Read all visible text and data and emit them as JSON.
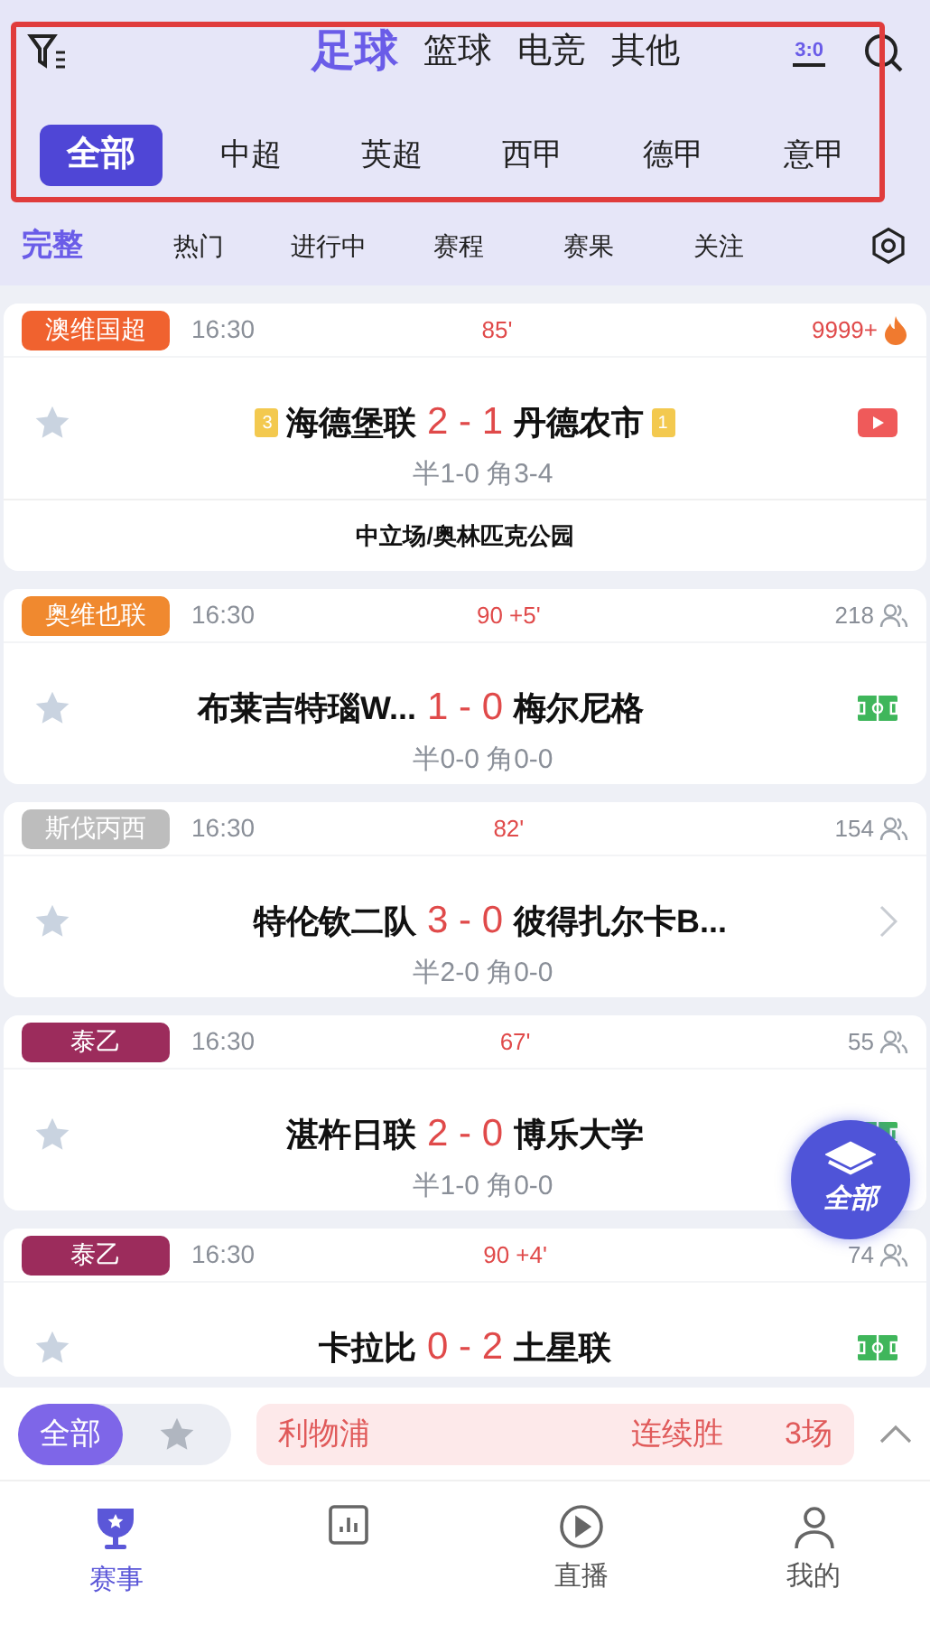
{
  "sports": [
    {
      "label": "足球",
      "selected": true
    },
    {
      "label": "篮球",
      "selected": false
    },
    {
      "label": "电竞",
      "selected": false
    },
    {
      "label": "其他",
      "selected": false
    }
  ],
  "score_toggle": "3:0",
  "leagues": [
    {
      "label": "全部",
      "selected": true
    },
    {
      "label": "中超",
      "selected": false
    },
    {
      "label": "英超",
      "selected": false
    },
    {
      "label": "西甲",
      "selected": false
    },
    {
      "label": "德甲",
      "selected": false
    },
    {
      "label": "意甲",
      "selected": false
    }
  ],
  "filters": [
    {
      "label": "完整",
      "selected": true
    },
    {
      "label": "热门",
      "selected": false
    },
    {
      "label": "进行中",
      "selected": false
    },
    {
      "label": "赛程",
      "selected": false
    },
    {
      "label": "赛果",
      "selected": false
    },
    {
      "label": "关注",
      "selected": false
    }
  ],
  "matches": [
    {
      "league": "澳维国超",
      "color": "#f0622f",
      "time": "16:30",
      "minute": "85'",
      "count": {
        "text": "9999+",
        "kind": "fire"
      },
      "home": "海德堡联",
      "home_rank": "3",
      "score": "2 - 1",
      "away": "丹德农市",
      "away_rank": "1",
      "stats": "半1-0 角3-4",
      "venue": "中立场/奥林匹克公园",
      "action": {
        "kind": "video"
      }
    },
    {
      "league": "奥维也联",
      "color": "#f0892f",
      "time": "16:30",
      "minute": "90 +5'",
      "count": {
        "text": "218",
        "kind": "people"
      },
      "home": "布莱吉特瑙W...",
      "score": "1 - 0",
      "away": "梅尔尼格",
      "stats": "半0-0 角0-0",
      "action": {
        "kind": "field"
      }
    },
    {
      "league": "斯伐丙西",
      "color": "#bdbdbd",
      "time": "16:30",
      "minute": "82'",
      "count": {
        "text": "154",
        "kind": "people"
      },
      "home": "特伦钦二队",
      "score": "3 - 0",
      "away": "彼得扎尔卡B...",
      "stats": "半2-0 角0-0",
      "action": {
        "kind": "chevron"
      }
    },
    {
      "league": "泰乙",
      "color": "#9c2c5c",
      "time": "16:30",
      "minute": "67'",
      "count": {
        "text": "55",
        "kind": "people"
      },
      "home": "湛杵日联",
      "score": "2 - 0",
      "away": "博乐大学",
      "stats": "半1-0 角0-0",
      "action": {
        "kind": "field"
      }
    },
    {
      "league": "泰乙",
      "color": "#9c2c5c",
      "time": "16:30",
      "minute": "90 +4'",
      "count": {
        "text": "74",
        "kind": "people"
      },
      "home": "卡拉比",
      "score": "0 - 2",
      "away": "土星联",
      "action": {
        "kind": "field"
      }
    }
  ],
  "fab": {
    "label": "全部"
  },
  "bottom_filter": {
    "options": [
      {
        "kind": "text",
        "label": "全部",
        "selected": true
      },
      {
        "kind": "star",
        "selected": false
      }
    ]
  },
  "ticker": {
    "team": "利物浦",
    "streak": "连续胜",
    "games": "3场"
  },
  "tab_bar": [
    {
      "label": "赛事",
      "selected": true
    },
    {
      "selected": false
    },
    {
      "label": "直播",
      "selected": false
    },
    {
      "label": "我的",
      "selected": false
    }
  ]
}
